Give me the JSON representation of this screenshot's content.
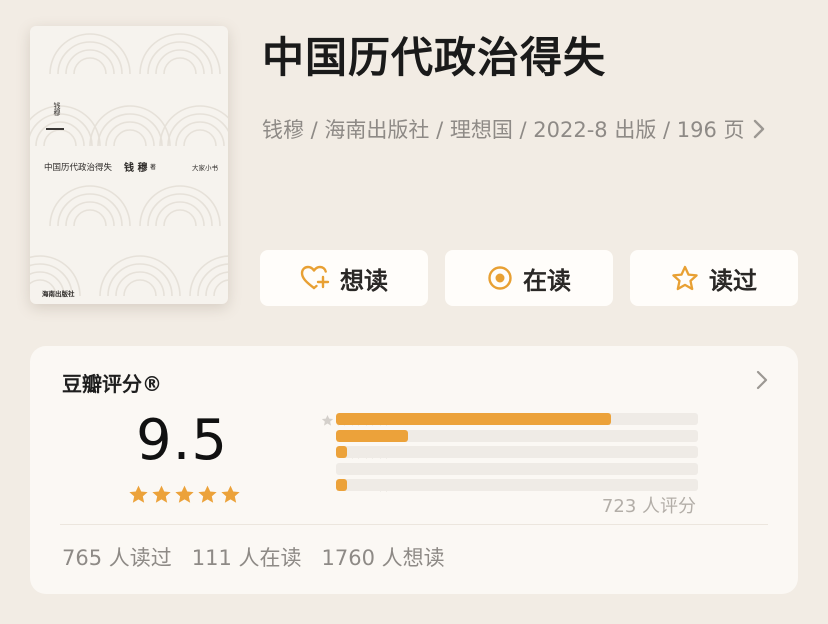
{
  "book": {
    "title": "中国历代政治得失",
    "meta": "钱穆 / 海南出版社 / 理想国 / 2022-8 出版 / 196 页",
    "cover": {
      "title_text": "中国历代政治得失",
      "author_text": "钱 穆",
      "author_suffix": "著",
      "series_text": "大家小书",
      "vertical_text": "钱穆",
      "publisher_mark": "海南出版社"
    }
  },
  "actions": {
    "want_label": "想读",
    "reading_label": "在读",
    "read_label": "读过"
  },
  "rating": {
    "title": "豆瓣评分®",
    "score": "9.5",
    "stars_filled": 5,
    "distribution": [
      {
        "stars": 5,
        "fraction": 0.76
      },
      {
        "stars": 4,
        "fraction": 0.2
      },
      {
        "stars": 3,
        "fraction": 0.03
      },
      {
        "stars": 2,
        "fraction": 0.0
      },
      {
        "stars": 1,
        "fraction": 0.03
      }
    ],
    "count_text": "723 人评分",
    "stats": {
      "read_text": "765 人读过",
      "reading_text": "111 人在读",
      "want_text": "1760 人想读"
    }
  },
  "colors": {
    "accent": "#eca23a",
    "background": "#f2ece4",
    "card": "#fbf8f4",
    "muted_text": "#8e8a86"
  },
  "icons": [
    "heart-plus-icon",
    "target-circle-icon",
    "star-outline-icon",
    "chevron-right-icon",
    "star-icon"
  ]
}
